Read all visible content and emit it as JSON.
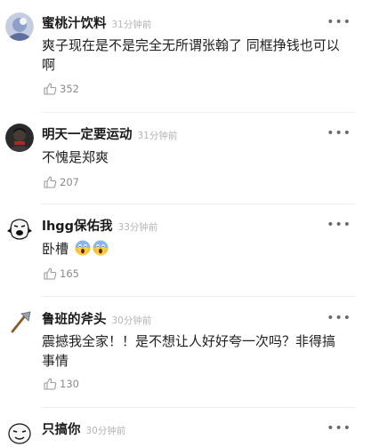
{
  "comments": [
    {
      "username": "蜜桃汁饮料",
      "time": "31分钟前",
      "text": "爽子现在是不是完全无所谓张翰了 同框挣钱也可以啊",
      "likes": "352"
    },
    {
      "username": "明天一定要运动",
      "time": "31分钟前",
      "text": "不愧是郑爽",
      "likes": "207"
    },
    {
      "username": "lhgg保佑我",
      "time": "33分钟前",
      "text": "卧槽",
      "likes": "165"
    },
    {
      "username": "鲁班的斧头",
      "time": "30分钟前",
      "text": "震撼我全家！！是不想让人好好夸一次吗？非得搞事情",
      "likes": "130"
    },
    {
      "username": "只搞你",
      "time": "30分钟前"
    }
  ],
  "icons": {
    "more": "more-options-icon",
    "like": "thumbs-up-icon",
    "emoji": "screaming-face-emoji"
  },
  "colors": {
    "username": "#1a1a1a",
    "timestamp": "#b4b4b4",
    "like_count": "#8a8a8a",
    "divider": "#efefef"
  }
}
